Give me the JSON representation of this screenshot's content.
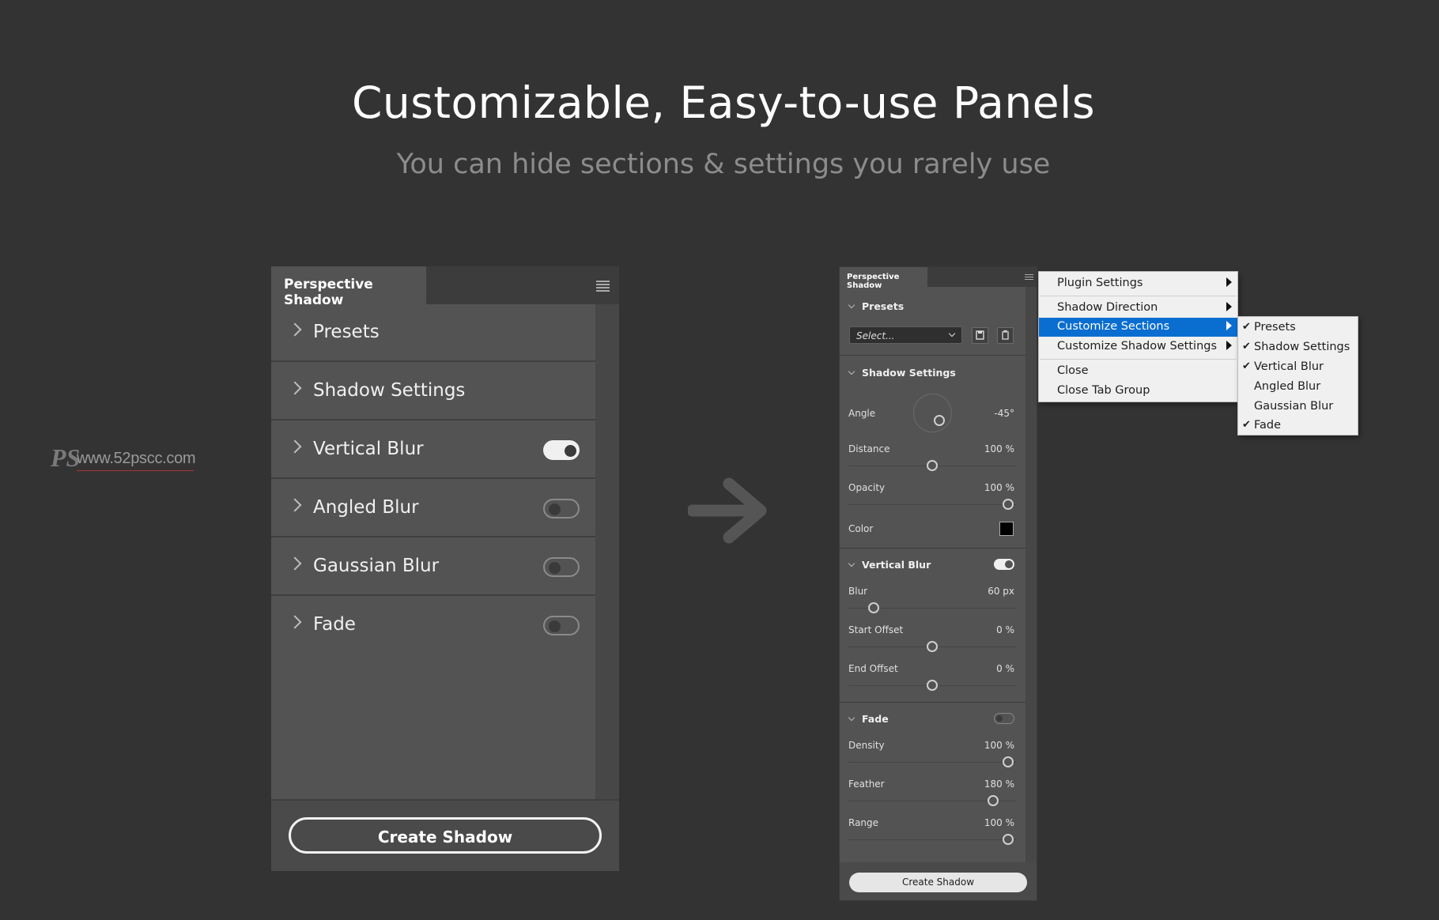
{
  "hero": {
    "title": "Customizable, Easy-to-use Panels",
    "subtitle": "You can hide sections & settings you rarely use"
  },
  "watermark": {
    "logo": "PS",
    "url": "www.52pscc.com"
  },
  "large_panel": {
    "tab": "Perspective Shadow",
    "menu_icon": "hamburger-icon",
    "sections": [
      {
        "label": "Presets",
        "toggle": null
      },
      {
        "label": "Shadow Settings",
        "toggle": null
      },
      {
        "label": "Vertical Blur",
        "toggle": true
      },
      {
        "label": "Angled Blur",
        "toggle": false
      },
      {
        "label": "Gaussian Blur",
        "toggle": false
      },
      {
        "label": "Fade",
        "toggle": false
      }
    ],
    "button": "Create Shadow"
  },
  "arrow_icon": "arrow-right-icon",
  "small_panel": {
    "tab": "Perspective Shadow",
    "presets": {
      "title": "Presets",
      "select_value": "Select...",
      "save_icon": "save-icon",
      "delete_icon": "trash-icon"
    },
    "shadow_settings": {
      "title": "Shadow Settings",
      "angle": {
        "label": "Angle",
        "value": "-45°"
      },
      "distance": {
        "label": "Distance",
        "value": "100 %"
      },
      "opacity": {
        "label": "Opacity",
        "value": "100 %"
      },
      "color": {
        "label": "Color",
        "hex": "#000000"
      }
    },
    "vertical_blur": {
      "title": "Vertical Blur",
      "enabled": true,
      "blur": {
        "label": "Blur",
        "value": "60 px"
      },
      "start_offset": {
        "label": "Start Offset",
        "value": "0 %"
      },
      "end_offset": {
        "label": "End Offset",
        "value": "0 %"
      }
    },
    "fade": {
      "title": "Fade",
      "enabled": false,
      "density": {
        "label": "Density",
        "value": "100 %"
      },
      "feather": {
        "label": "Feather",
        "value": "180 %"
      },
      "range": {
        "label": "Range",
        "value": "100 %"
      }
    },
    "button": "Create Shadow"
  },
  "context_menu": {
    "items": [
      {
        "label": "Plugin Settings",
        "submenu": true
      },
      {
        "label": "Shadow Direction",
        "submenu": true
      },
      {
        "label": "Customize Sections",
        "submenu": true,
        "highlighted": true
      },
      {
        "label": "Customize Shadow Settings",
        "submenu": true
      },
      {
        "label": "Close"
      },
      {
        "label": "Close Tab Group"
      }
    ],
    "highlight_color": "#0a6ed1"
  },
  "submenu": {
    "items": [
      {
        "label": "Presets",
        "checked": true
      },
      {
        "label": "Shadow Settings",
        "checked": true
      },
      {
        "label": "Vertical Blur",
        "checked": true
      },
      {
        "label": "Angled Blur",
        "checked": false
      },
      {
        "label": "Gaussian Blur",
        "checked": false
      },
      {
        "label": "Fade",
        "checked": true
      }
    ],
    "check_glyph": "✔"
  }
}
